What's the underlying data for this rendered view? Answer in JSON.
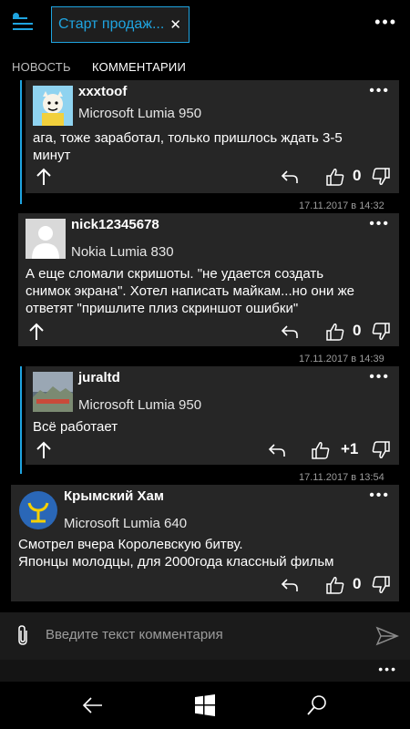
{
  "header": {
    "tab_title": "Старт продаж...",
    "close_glyph": "✕",
    "more_glyph": "•••",
    "accent_color": "#1fa4e0"
  },
  "tabs": [
    {
      "label": "НОВОСТЬ"
    },
    {
      "label": "КОММЕНТАРИИ"
    }
  ],
  "comments": [
    {
      "author": "xxxtoof",
      "device": "Microsoft Lumia 950",
      "text_lines": [
        "ага, тоже заработал, только пришлось ждать 3-5",
        "минут"
      ],
      "score": "0",
      "timestamp": "17.11.2017 в 14:32"
    },
    {
      "author": "nick12345678",
      "device": "Nokia Lumia 830",
      "text_lines": [
        "А еще сломали скришоты. \"не удается создать",
        "снимок экрана\". Хотел написать майкам...но они же",
        "ответят \"пришлите плиз скриншот ошибки\""
      ],
      "score": "0",
      "timestamp": "17.11.2017 в 14:39"
    },
    {
      "author": "juraltd",
      "device": "Microsoft Lumia 950",
      "text_lines": [
        "Всё работает"
      ],
      "score": "+1",
      "timestamp": "17.11.2017 в 13:54"
    },
    {
      "author": "Крымский Хам",
      "device": "Microsoft Lumia 640",
      "text_lines": [
        "Смотрел вчера Королевскую битву.",
        "Японцы молодцы, для 2000года классный фильм"
      ],
      "score": "0"
    }
  ],
  "composer": {
    "placeholder": "Введите текст комментария"
  },
  "icons": {
    "menu": "hamburger-icon",
    "reply": "reply-icon",
    "like": "thumbs-up-icon",
    "dislike": "thumbs-down-icon",
    "up": "arrow-up-icon",
    "attach": "paperclip-icon",
    "send": "send-icon",
    "back": "back-icon",
    "windows": "windows-icon",
    "search": "search-icon"
  }
}
